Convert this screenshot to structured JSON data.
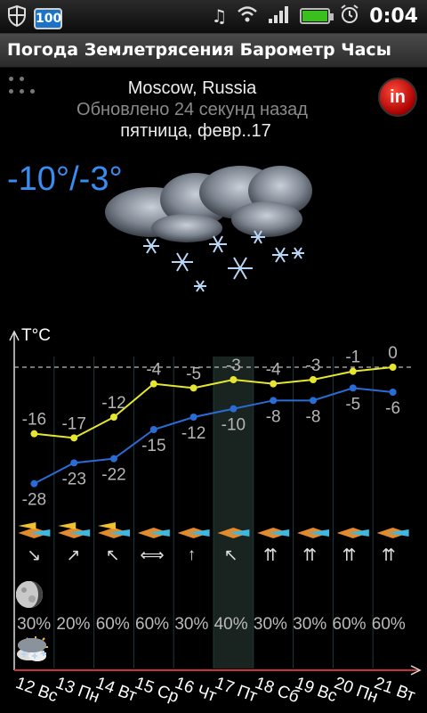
{
  "status_bar": {
    "battery_badge": "100",
    "time": "0:04",
    "icons": [
      "shield-icon",
      "battery-badge-icon",
      "music-note-icon",
      "wifi-icon",
      "signal-icon",
      "battery-icon",
      "alarm-icon"
    ]
  },
  "title_bar": {
    "title": "Погода Землетрясения Барометр Часы"
  },
  "header": {
    "city": "Moscow, Russia",
    "updated": "Обновлено 24 секунд назад",
    "date": "пятница, февр..17",
    "current_temp": "-10°/-3°",
    "weather_icon": "snow-cloud-icon",
    "in_button_label": "in"
  },
  "forecast": {
    "unit_label": "T°C",
    "days": [
      {
        "label": "12 Вс",
        "high": "-16",
        "low": "-28",
        "wind": "↘",
        "precip": "30%",
        "icon": "snow-icon"
      },
      {
        "label": "13 Пн",
        "high": "-17",
        "low": "-23",
        "wind": "↗",
        "precip": "20%",
        "icon": "sun-cloud-icon"
      },
      {
        "label": "14 Вт",
        "high": "-12",
        "low": "-22",
        "wind": "↖",
        "precip": "60%",
        "icon": "sun-cloud-icon"
      },
      {
        "label": "15 Ср",
        "high": "-4",
        "low": "-15",
        "wind": "⟺",
        "precip": "60%",
        "icon": "snow-icon"
      },
      {
        "label": "16 Чт",
        "high": "-5",
        "low": "-12",
        "wind": "↑",
        "precip": "30%",
        "icon": "snow-icon"
      },
      {
        "label": "17 Пт",
        "high": "-3",
        "low": "-10",
        "wind": "↖",
        "precip": "40%",
        "icon": "snow-icon"
      },
      {
        "label": "18 Сб",
        "high": "-4",
        "low": "-8",
        "wind": "⇈",
        "precip": "30%",
        "icon": "snow-icon"
      },
      {
        "label": "19 Вс",
        "high": "-3",
        "low": "-8",
        "wind": "⇈",
        "precip": "30%",
        "icon": "snow-icon"
      },
      {
        "label": "20 Пн",
        "high": "-1",
        "low": "-5",
        "wind": "⇈",
        "precip": "60%",
        "icon": "snow-icon"
      },
      {
        "label": "21 Вт",
        "high": "0",
        "low": "-6",
        "wind": "⇈",
        "precip": "60%",
        "icon": "snow-icon"
      }
    ]
  },
  "chart_data": {
    "type": "line",
    "title": "",
    "ylabel": "T°C",
    "x": [
      "12 Вс",
      "13 Пн",
      "14 Вт",
      "15 Ср",
      "16 Чт",
      "17 Пт",
      "18 Сб",
      "19 Вс",
      "20 Пн",
      "21 Вт"
    ],
    "series": [
      {
        "color": "#e6e630",
        "values": [
          -16,
          -17,
          -12,
          -4,
          -5,
          -3,
          -4,
          -3,
          -1,
          0
        ]
      },
      {
        "color": "#2a6cd6",
        "values": [
          -28,
          -23,
          -22,
          -15,
          -12,
          -10,
          -8,
          -8,
          -5,
          -6
        ]
      }
    ],
    "ylim": [
      -30,
      0
    ],
    "grid": false,
    "highlight_day": "17 Пт"
  },
  "colors": {
    "temp_accent": "#3a8df0",
    "high_line": "#e6e630",
    "low_line": "#2a6cd6",
    "today_highlight": "#2a3a35"
  }
}
